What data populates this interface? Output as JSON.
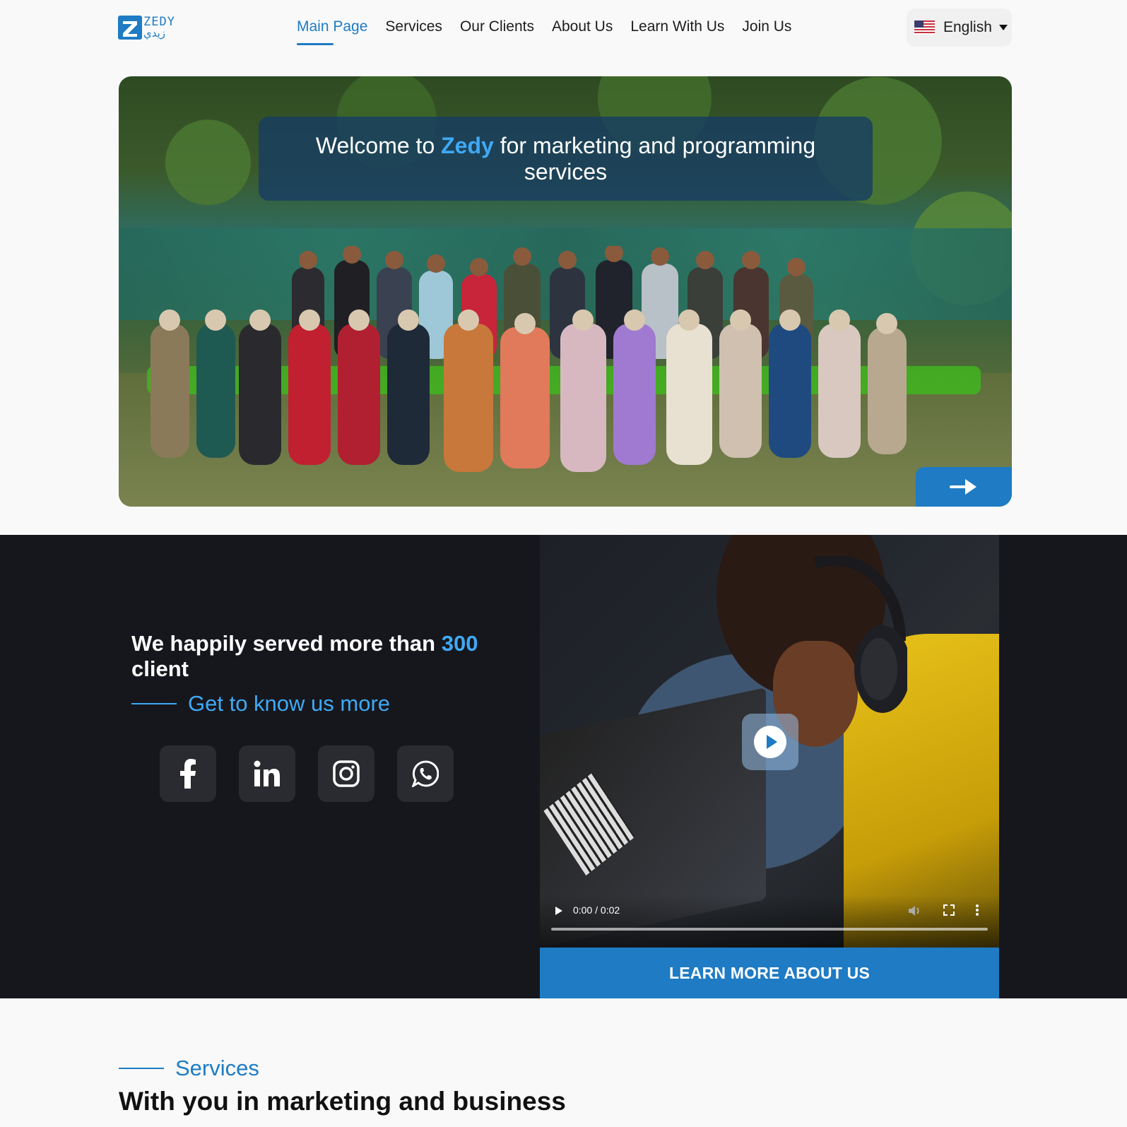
{
  "nav": {
    "logo": {
      "text_en": "ZEDY",
      "text_ar": "زيدي"
    },
    "menu": [
      {
        "label": "Main Page",
        "active": true
      },
      {
        "label": "Services"
      },
      {
        "label": "Our Clients"
      },
      {
        "label": "About Us"
      },
      {
        "label": "Learn With Us"
      },
      {
        "label": "Join Us"
      }
    ],
    "language": {
      "label": "English",
      "flag": "us-flag-icon"
    }
  },
  "hero": {
    "title_before": "Welcome to ",
    "title_brand": "Zedy",
    "title_after": " for marketing and programming services",
    "next_icon": "arrow-right-icon"
  },
  "about": {
    "served_before": "We happily served more than ",
    "served_count": "300",
    "served_after": " client",
    "know_more": "Get to know us more",
    "socials": [
      "facebook-icon",
      "linkedin-icon",
      "instagram-icon",
      "whatsapp-icon"
    ],
    "video": {
      "time": "0:00 / 0:02"
    },
    "learn_more": "LEARN MORE ABOUT US"
  },
  "services": {
    "tag": "Services",
    "heading": "With you in marketing and business"
  },
  "colors": {
    "accent": "#1e7bc4",
    "accent_light": "#3fa9f5",
    "dark_bg": "#16171d"
  }
}
